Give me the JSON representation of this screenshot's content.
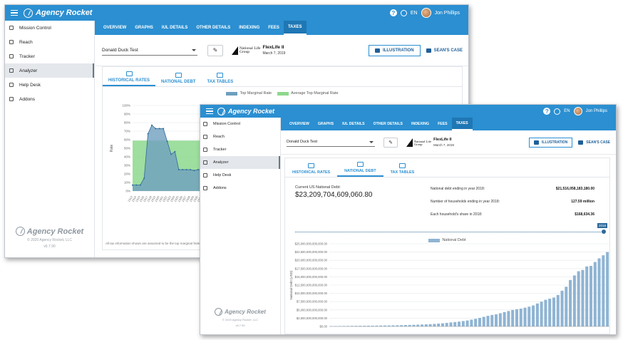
{
  "app": {
    "name": "Agency Rocket",
    "user": "Jon Phillips",
    "lang": "EN"
  },
  "nav": [
    {
      "label": "Mission Control"
    },
    {
      "label": "Reach"
    },
    {
      "label": "Tracker"
    },
    {
      "label": "Analyzer"
    },
    {
      "label": "Help Desk"
    },
    {
      "label": "Addons"
    }
  ],
  "sidebar_footer": {
    "brand": "Agency Rocket",
    "copyright": "© 2020 Agency Rocket, LLC",
    "version": "v6.7.90"
  },
  "tabs": [
    "OVERVIEW",
    "GRAPHS",
    "IUL DETAILS",
    "OTHER DETAILS",
    "INDEXING",
    "FEES",
    "TAXES"
  ],
  "active_tab": "TAXES",
  "client": "Donald Duck Test",
  "carrier": {
    "name_line1": "National Life",
    "name_line2": "Group",
    "product": "FlexLife II",
    "date": "March 7, 2019"
  },
  "buttons": {
    "illustration": "ILLUSTRATION",
    "case": "SEAN'S CASE"
  },
  "subtabs": [
    "HISTORICAL RATES",
    "NATIONAL DEBT",
    "TAX TABLES"
  ],
  "window1": {
    "active_subtab": "HISTORICAL RATES",
    "footnote": "All tax information shown are assumed to be the top marginal feder"
  },
  "window2": {
    "active_subtab": "NATIONAL DEBT",
    "debt_label": "Current US National Debt:",
    "debt_value": "$23,209,704,609,060.80",
    "stats": [
      {
        "label": "National debt ending in year 2018:",
        "value": "$21,516,058,183,180.00"
      },
      {
        "label": "Number of households ending in year 2018:",
        "value": "127.59 million"
      },
      {
        "label": "Each household's share in 2018:",
        "value": "$168,634.36"
      }
    ],
    "slider_year": "2018"
  },
  "colors": {
    "primary": "#2b8fd1",
    "top_marginal": "#6f9fbf",
    "avg_marginal": "#8dd88d",
    "debt_bar": "#8fb4d3"
  },
  "chart_data": [
    {
      "type": "area",
      "series": [
        {
          "name": "Top Marginal Rate",
          "x": [
            1913,
            1914,
            1915,
            1916,
            1917,
            1918,
            1919,
            1920,
            1921,
            1922,
            1923,
            1924,
            1925,
            1926,
            1927,
            1928,
            1929,
            1930,
            1931,
            1932,
            1933
          ],
          "values": [
            7,
            7,
            7,
            15,
            67,
            77,
            73,
            73,
            73,
            58,
            43,
            46,
            25,
            25,
            25,
            25,
            24,
            25,
            25,
            63,
            63
          ]
        },
        {
          "name": "Average Top Marginal Rate",
          "values": [
            59
          ]
        }
      ],
      "ylabel": "Rate",
      "ylim": [
        0,
        100
      ],
      "yticks": [
        "0%",
        "10%",
        "20%",
        "30%",
        "40%",
        "50%",
        "60%",
        "70%",
        "80%",
        "90%",
        "100%"
      ],
      "legend": "top-center"
    },
    {
      "type": "bar",
      "series": [
        {
          "name": "National Debt",
          "values": [
            0.1,
            0.12,
            0.13,
            0.14,
            0.16,
            0.18,
            0.19,
            0.2,
            0.21,
            0.22,
            0.23,
            0.25,
            0.27,
            0.29,
            0.3,
            0.32,
            0.35,
            0.39,
            0.43,
            0.46,
            0.5,
            0.54,
            0.58,
            0.64,
            0.7,
            0.77,
            0.86,
            0.96,
            1.08,
            1.21,
            1.34,
            1.47,
            1.63,
            1.81,
            2.05,
            2.31,
            2.6,
            2.91,
            3.21,
            3.48,
            3.66,
            4.0,
            4.35,
            4.66,
            5.0,
            5.21,
            5.38,
            5.68,
            5.98,
            6.35,
            6.95,
            7.48,
            8.06,
            8.4,
            8.74,
            9.51,
            10.81,
            12.01,
            14.05,
            15.42,
            16.69,
            17.08,
            18.14,
            18.3,
            19.48,
            20.59,
            21.52,
            22.5
          ]
        }
      ],
      "ylabel": "National Debt (USD)",
      "ylim": [
        0,
        25000000000000
      ],
      "yticks": [
        "$0.00",
        "$2,500,000,000,000.00",
        "$5,000,000,000,000.00",
        "$7,500,000,000,000.00",
        "$10,000,000,000,000.00",
        "$12,500,000,000,000.00",
        "$15,000,000,000,000.00",
        "$17,500,000,000,000.00",
        "$20,000,000,000,000.00",
        "$22,500,000,000,000.00",
        "$25,000,000,000,000.00"
      ],
      "legend": "top-center"
    }
  ]
}
